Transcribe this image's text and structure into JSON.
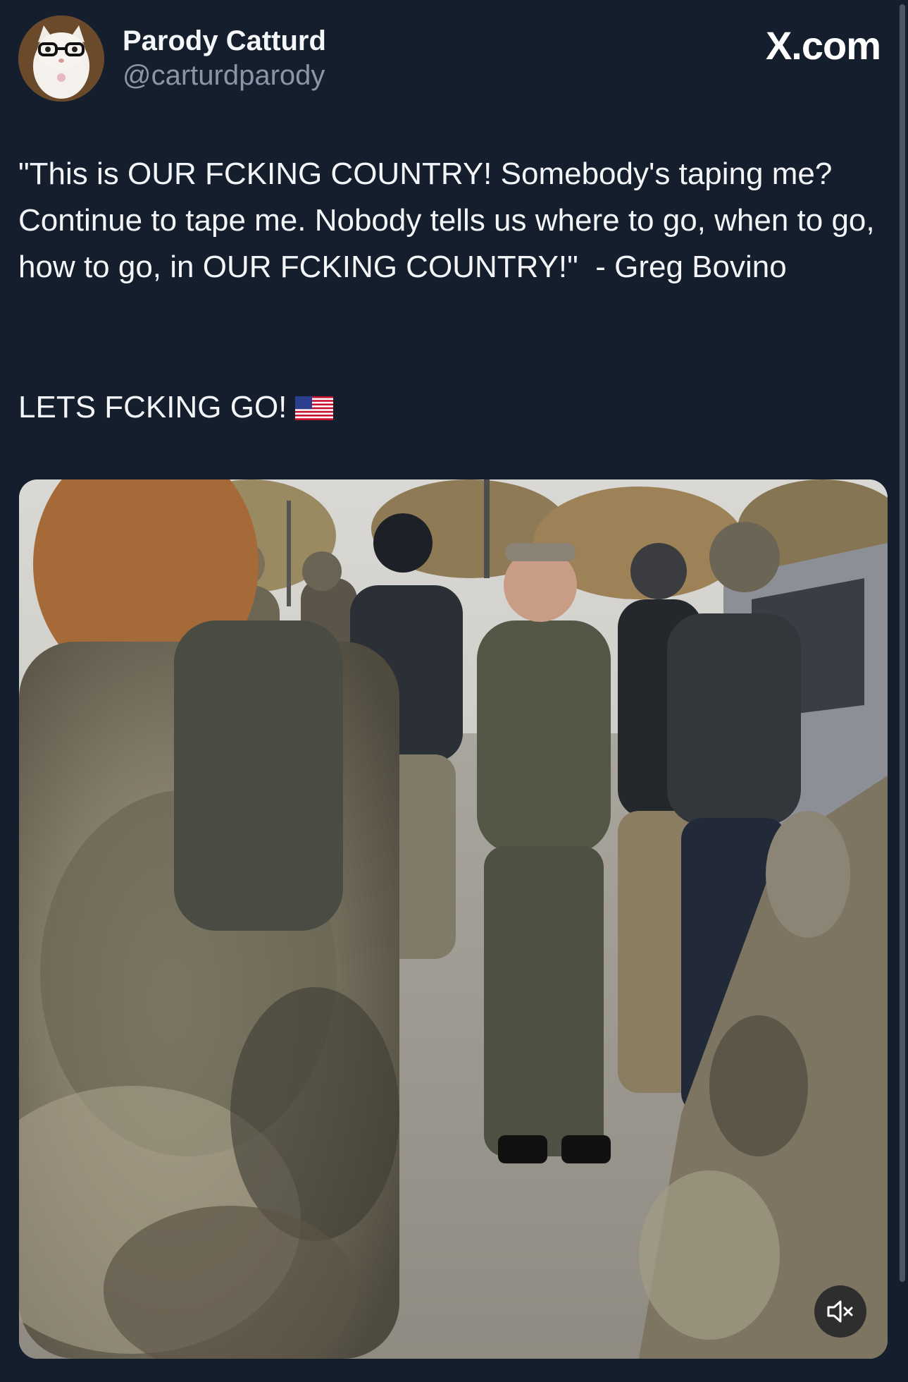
{
  "header": {
    "display_name": "Parody Catturd",
    "handle": "@carturdparody",
    "brand": "X.com"
  },
  "tweet": {
    "text": "\"This is OUR FCKING COUNTRY! Somebody's taping me? Continue to tape me. Nobody tells us where to go, when to go, how to go, in OUR FCKING COUNTRY!\"  - Greg Bovino",
    "text_line2": "LETS FCKING GO!",
    "emoji": "flag-us-icon"
  },
  "media": {
    "type": "video",
    "description_icon": "video-thumbnail",
    "control": "mute-icon"
  },
  "colors": {
    "background": "#151e2c",
    "handle": "#8a96a6",
    "text": "#f3f5f8"
  }
}
